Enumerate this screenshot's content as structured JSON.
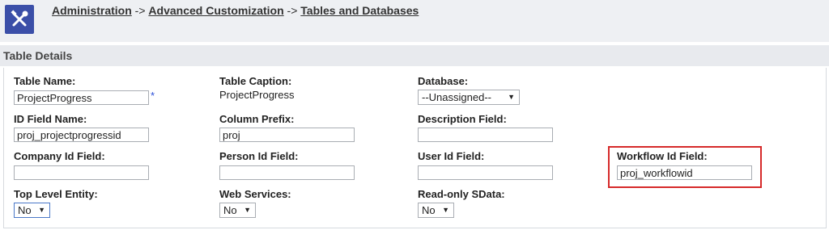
{
  "breadcrumb": {
    "items": [
      "Administration",
      "Advanced Customization",
      "Tables and Databases"
    ],
    "separator": "->"
  },
  "section": {
    "title": "Table Details"
  },
  "fields": {
    "table_name": {
      "label": "Table Name:",
      "value": "ProjectProgress",
      "required_mark": "*"
    },
    "table_caption": {
      "label": "Table Caption:",
      "value": "ProjectProgress"
    },
    "database": {
      "label": "Database:",
      "selected": "--Unassigned--"
    },
    "id_field_name": {
      "label": "ID Field Name:",
      "value": "proj_projectprogressid"
    },
    "column_prefix": {
      "label": "Column Prefix:",
      "value": "proj"
    },
    "description_field": {
      "label": "Description Field:",
      "value": ""
    },
    "company_id_field": {
      "label": "Company Id Field:",
      "value": ""
    },
    "person_id_field": {
      "label": "Person Id Field:",
      "value": ""
    },
    "user_id_field": {
      "label": "User Id Field:",
      "value": ""
    },
    "workflow_id_field": {
      "label": "Workflow Id Field:",
      "value": "proj_workflowid"
    },
    "top_level_entity": {
      "label": "Top Level Entity:",
      "selected": "No"
    },
    "web_services": {
      "label": "Web Services:",
      "selected": "No"
    },
    "readonly_sdata": {
      "label": "Read-only SData:",
      "selected": "No"
    }
  },
  "colors": {
    "logo_bg": "#3b4fa8",
    "highlight": "#d62a2a",
    "required": "#2a4ed8"
  },
  "icons": {
    "logo": "tools-icon"
  }
}
